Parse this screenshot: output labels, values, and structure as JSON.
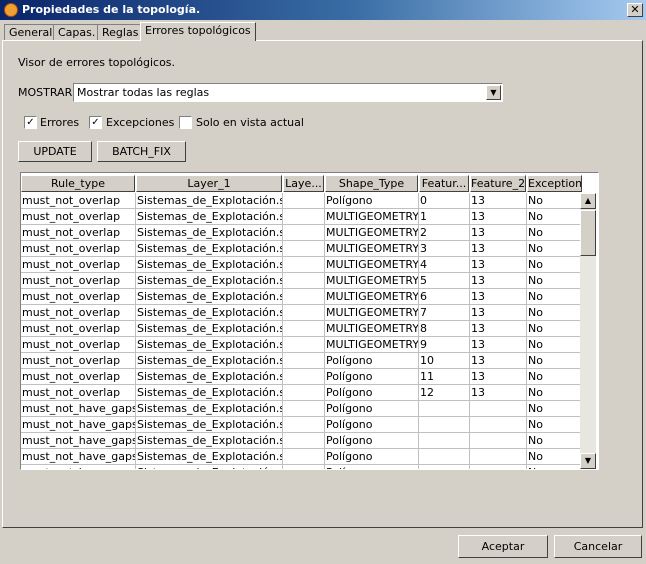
{
  "window": {
    "title": "Propiedades de la topología.",
    "close_glyph": "✕"
  },
  "tabs": [
    {
      "label": "General"
    },
    {
      "label": "Capas."
    },
    {
      "label": "Reglas"
    },
    {
      "label": "Errores topológicos",
      "active": true
    }
  ],
  "panel": {
    "heading": "Visor de errores topológicos.",
    "mostrar_label": "MOSTRAR",
    "mostrar_value": "Mostrar todas las reglas",
    "checkboxes": [
      {
        "label": "Errores",
        "checked": true
      },
      {
        "label": "Excepciones",
        "checked": true
      },
      {
        "label": "Solo en vista actual",
        "checked": false
      }
    ],
    "update_label": "UPDATE",
    "batch_fix_label": "BATCH_FIX"
  },
  "table": {
    "columns": [
      "Rule_type",
      "Layer_1",
      "Laye...",
      "Shape_Type",
      "Featur...",
      "Feature_2",
      "Exception"
    ],
    "rows": [
      [
        "must_not_overlap",
        "Sistemas_de_Explotación.shp",
        "",
        "Polígono",
        "0",
        "13",
        "No"
      ],
      [
        "must_not_overlap",
        "Sistemas_de_Explotación.shp",
        "",
        "MULTIGEOMETRY",
        "1",
        "13",
        "No"
      ],
      [
        "must_not_overlap",
        "Sistemas_de_Explotación.shp",
        "",
        "MULTIGEOMETRY",
        "2",
        "13",
        "No"
      ],
      [
        "must_not_overlap",
        "Sistemas_de_Explotación.shp",
        "",
        "MULTIGEOMETRY",
        "3",
        "13",
        "No"
      ],
      [
        "must_not_overlap",
        "Sistemas_de_Explotación.shp",
        "",
        "MULTIGEOMETRY",
        "4",
        "13",
        "No"
      ],
      [
        "must_not_overlap",
        "Sistemas_de_Explotación.shp",
        "",
        "MULTIGEOMETRY",
        "5",
        "13",
        "No"
      ],
      [
        "must_not_overlap",
        "Sistemas_de_Explotación.shp",
        "",
        "MULTIGEOMETRY",
        "6",
        "13",
        "No"
      ],
      [
        "must_not_overlap",
        "Sistemas_de_Explotación.shp",
        "",
        "MULTIGEOMETRY",
        "7",
        "13",
        "No"
      ],
      [
        "must_not_overlap",
        "Sistemas_de_Explotación.shp",
        "",
        "MULTIGEOMETRY",
        "8",
        "13",
        "No"
      ],
      [
        "must_not_overlap",
        "Sistemas_de_Explotación.shp",
        "",
        "MULTIGEOMETRY",
        "9",
        "13",
        "No"
      ],
      [
        "must_not_overlap",
        "Sistemas_de_Explotación.shp",
        "",
        "Polígono",
        "10",
        "13",
        "No"
      ],
      [
        "must_not_overlap",
        "Sistemas_de_Explotación.shp",
        "",
        "Polígono",
        "11",
        "13",
        "No"
      ],
      [
        "must_not_overlap",
        "Sistemas_de_Explotación.shp",
        "",
        "Polígono",
        "12",
        "13",
        "No"
      ],
      [
        "must_not_have_gaps",
        "Sistemas_de_Explotación.shp",
        "",
        "Polígono",
        "",
        "",
        "No"
      ],
      [
        "must_not_have_gaps",
        "Sistemas_de_Explotación.shp",
        "",
        "Polígono",
        "",
        "",
        "No"
      ],
      [
        "must_not_have_gaps",
        "Sistemas_de_Explotación.shp",
        "",
        "Polígono",
        "",
        "",
        "No"
      ],
      [
        "must_not_have_gaps",
        "Sistemas_de_Explotación.shp",
        "",
        "Polígono",
        "",
        "",
        "No"
      ],
      [
        "must_not_have_gaps",
        "Sistemas_de_Explotación.shp",
        "",
        "Polígono",
        "",
        "",
        "No"
      ]
    ]
  },
  "footer": {
    "accept_label": "Aceptar",
    "cancel_label": "Cancelar"
  }
}
